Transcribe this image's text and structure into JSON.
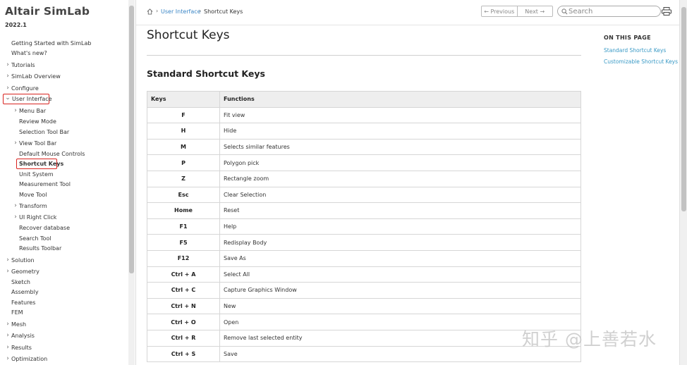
{
  "sidebar": {
    "brand": "Altair SimLab",
    "version": "2022.1",
    "items": [
      {
        "label": "Getting Started with SimLab",
        "chevron": ""
      },
      {
        "label": "What's new?",
        "chevron": ""
      },
      {
        "label": "Tutorials",
        "chevron": "›"
      },
      {
        "label": "SimLab Overview",
        "chevron": "›"
      },
      {
        "label": "Configure",
        "chevron": "›"
      },
      {
        "label": "User Interface",
        "chevron": "⌄"
      },
      {
        "label": "Menu Bar",
        "chevron": "›"
      },
      {
        "label": "Review Mode",
        "chevron": ""
      },
      {
        "label": "Selection Tool Bar",
        "chevron": ""
      },
      {
        "label": "View Tool Bar",
        "chevron": "›"
      },
      {
        "label": "Default Mouse Controls",
        "chevron": ""
      },
      {
        "label": "Shortcut Keys",
        "chevron": ""
      },
      {
        "label": "Unit System",
        "chevron": ""
      },
      {
        "label": "Measurement Tool",
        "chevron": ""
      },
      {
        "label": "Move Tool",
        "chevron": ""
      },
      {
        "label": "Transform",
        "chevron": "›"
      },
      {
        "label": "UI Right Click",
        "chevron": "›"
      },
      {
        "label": "Recover database",
        "chevron": ""
      },
      {
        "label": "Search Tool",
        "chevron": ""
      },
      {
        "label": "Results Toolbar",
        "chevron": ""
      },
      {
        "label": "Solution",
        "chevron": "›"
      },
      {
        "label": "Geometry",
        "chevron": "›"
      },
      {
        "label": "Sketch",
        "chevron": ""
      },
      {
        "label": "Assembly",
        "chevron": ""
      },
      {
        "label": "Features",
        "chevron": ""
      },
      {
        "label": "FEM",
        "chevron": ""
      },
      {
        "label": "Mesh",
        "chevron": "›"
      },
      {
        "label": "Analysis",
        "chevron": "›"
      },
      {
        "label": "Results",
        "chevron": "›"
      },
      {
        "label": "Optimization",
        "chevron": "›"
      }
    ]
  },
  "breadcrumb": {
    "icon": "home-icon",
    "sep": "›",
    "parent": "User Interface",
    "current": "Shortcut Keys"
  },
  "nav": {
    "previous": "← Previous",
    "next": "Next →"
  },
  "search": {
    "placeholder": "Search"
  },
  "page": {
    "title": "Shortcut Keys",
    "section_title": "Standard Shortcut Keys",
    "table": {
      "headers": [
        "Keys",
        "Functions"
      ],
      "rows": [
        [
          "F",
          "Fit view"
        ],
        [
          "H",
          "Hide"
        ],
        [
          "M",
          "Selects similar features"
        ],
        [
          "P",
          "Polygon pick"
        ],
        [
          "Z",
          "Rectangle zoom"
        ],
        [
          "Esc",
          "Clear Selection"
        ],
        [
          "Home",
          "Reset"
        ],
        [
          "F1",
          "Help"
        ],
        [
          "F5",
          "Redisplay Body"
        ],
        [
          "F12",
          "Save As"
        ],
        [
          "Ctrl + A",
          "Select All"
        ],
        [
          "Ctrl + C",
          "Capture Graphics Window"
        ],
        [
          "Ctrl + N",
          "New"
        ],
        [
          "Ctrl + O",
          "Open"
        ],
        [
          "Ctrl + R",
          "Remove last selected entity"
        ],
        [
          "Ctrl + S",
          "Save"
        ]
      ]
    }
  },
  "on_this_page": {
    "heading": "ON THIS PAGE",
    "links": [
      "Standard Shortcut Keys",
      "Customizable Shortcut Keys"
    ]
  },
  "watermark": "知乎 @上善若水",
  "colors": {
    "link": "#3a86c6",
    "highlight_box": "#d9231f",
    "table_header_bg": "#eeeeee"
  }
}
